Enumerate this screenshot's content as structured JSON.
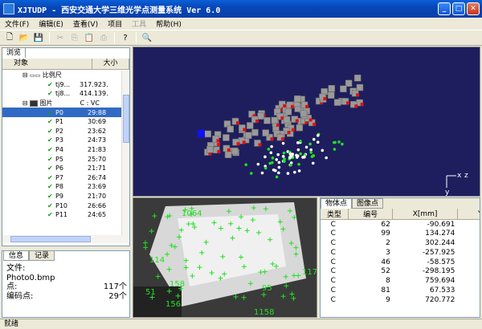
{
  "window": {
    "title": "XJTUDP - 西安交通大学三维光学点测量系统 Ver 6.0"
  },
  "menu": [
    "文件(F)",
    "编辑(E)",
    "查看(V)",
    "项目",
    "工具",
    "帮助(H)"
  ],
  "menu_disabled_index": 4,
  "left": {
    "tab": "浏览",
    "col_object": "对象",
    "col_size": "大小",
    "scale_label": "比例尺",
    "scale_items": [
      {
        "name": "tj9...",
        "size": "317.923."
      },
      {
        "name": "tj8...",
        "size": "414.139."
      }
    ],
    "photo_label": "图片",
    "photo_size": "C : VC",
    "photos": [
      {
        "name": "P0",
        "size": "29:88"
      },
      {
        "name": "P1",
        "size": "30:69"
      },
      {
        "name": "P2",
        "size": "23:62"
      },
      {
        "name": "P3",
        "size": "24:73"
      },
      {
        "name": "P4",
        "size": "21:83"
      },
      {
        "name": "P5",
        "size": "25:70"
      },
      {
        "name": "P6",
        "size": "21:71"
      },
      {
        "name": "P7",
        "size": "26:74"
      },
      {
        "name": "P8",
        "size": "23:69"
      },
      {
        "name": "P9",
        "size": "21:70"
      },
      {
        "name": "P10",
        "size": "26:66"
      },
      {
        "name": "P11",
        "size": "24:65"
      }
    ],
    "selected_index": 0
  },
  "info": {
    "tab_info": "信息",
    "tab_log": "记录",
    "file_label": "文件:",
    "file_value": "Photo0.bmp",
    "points_label": "点:",
    "points_value": "117个",
    "coded_label": "编码点:",
    "coded_value": "29个"
  },
  "table": {
    "tab_object_points": "物体点",
    "tab_image_points": "图像点",
    "headers": [
      "类型",
      "编号",
      "X[mm]",
      "Y[m"
    ],
    "rows": [
      [
        "C",
        "62",
        "-90.691",
        "-424"
      ],
      [
        "C",
        "99",
        "134.274",
        "-283"
      ],
      [
        "C",
        "2",
        "302.244",
        "-158"
      ],
      [
        "C",
        "3",
        "-257.925",
        "-312"
      ],
      [
        "C",
        "46",
        "-58.575",
        "-241"
      ],
      [
        "C",
        "52",
        "-298.195",
        "-280"
      ],
      [
        "C",
        "8",
        "759.694",
        "125"
      ],
      [
        "C",
        "81",
        "67.533",
        "-108"
      ],
      [
        "C",
        "9",
        "720.772",
        "141"
      ]
    ]
  },
  "axes": {
    "x": "x",
    "y": "y",
    "z": "z"
  },
  "photo_labels": [
    "1064",
    "114",
    "51",
    "1158",
    "95",
    "1172",
    "156",
    "158"
  ],
  "status": "就绪"
}
